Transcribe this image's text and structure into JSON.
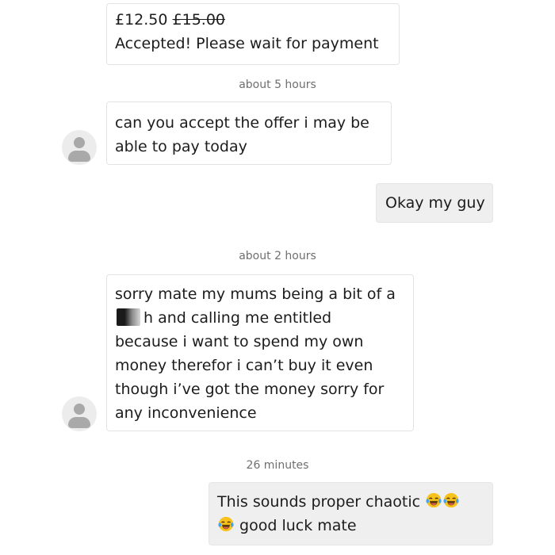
{
  "messages": [
    {
      "price": "£12.50",
      "original_price": "£15.00",
      "text": "Accepted! Please wait for payment"
    },
    {
      "timestamp": "about 5 hours",
      "lines": [
        "can you accept the offer i may be",
        "able to pay today"
      ]
    },
    {
      "text": "Okay my guy"
    },
    {
      "timestamp": "about 2 hours",
      "line1": "sorry mate my mums being a bit of a",
      "line2_after_censor": "h and calling me entitled",
      "lines_rest": [
        "because i want to spend my own",
        "money therefor i can’t buy it even",
        "though i’ve got the money sorry for",
        "any inconvenience"
      ]
    },
    {
      "timestamp": "26 minutes",
      "line1": "This sounds proper chaotic",
      "line2": "good luck mate",
      "emoji": "face-with-tears-of-joy-icon"
    }
  ],
  "colors": {
    "incoming_bubble": "#ffffff",
    "outgoing_bubble": "#efefef",
    "border": "#e3e3e3",
    "timestamp": "#6f6f6f",
    "emoji_face": "#f7c21b"
  }
}
